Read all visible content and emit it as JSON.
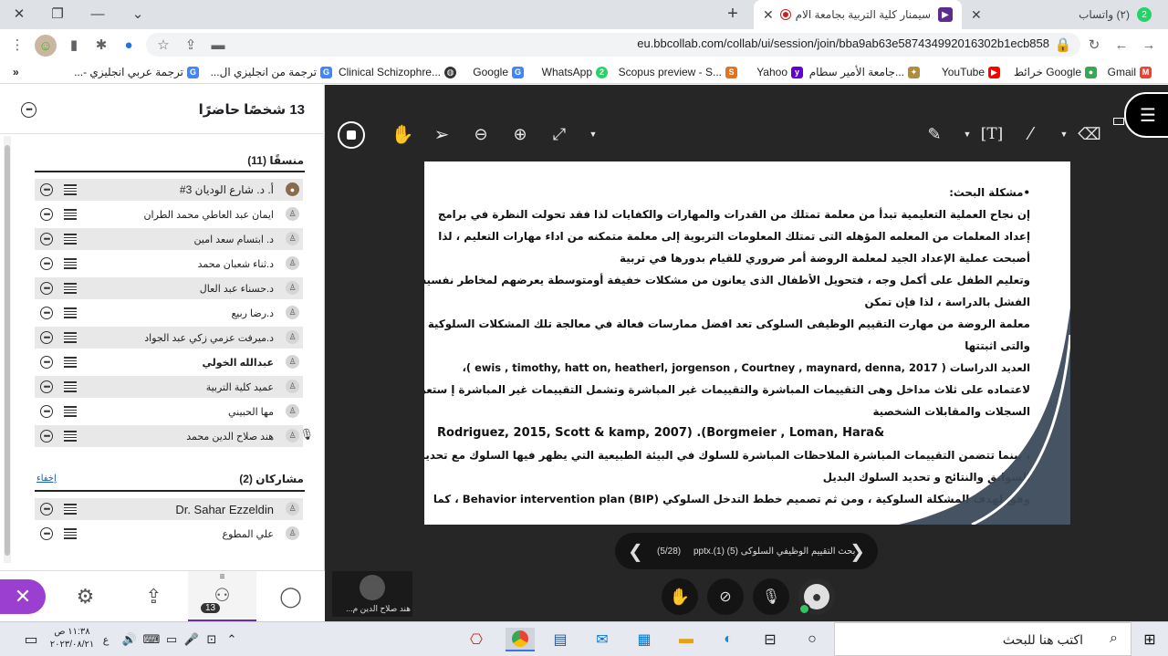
{
  "browser": {
    "tabs": [
      {
        "title": "(٢) واتساب",
        "badge": "2"
      },
      {
        "title": "سيمنار كلية التربية بجامعة الام",
        "active": true
      }
    ],
    "url": "eu.bbcollab.com/collab/ui/session/join/bba9ab63e587434992016302b1ecb858",
    "bookmarks": [
      "Gmail",
      "خرائط Google",
      "YouTube",
      "جامعة الأمير سطام...",
      "Yahoo",
      "Scopus preview - S...",
      "WhatsApp",
      "Google",
      "Clinical Schizophre...",
      "ترجمة من انجليزي ال...",
      "ترجمة عربي انجليزي -..."
    ],
    "more_bookmarks": "»"
  },
  "panel": {
    "title": "13 شخصًا حاضرًا",
    "moderators_heading": "منسقًا (11)",
    "moderators": [
      "أ. د. شارع الوديان 3#",
      "ايمان عبد العاطي محمد الطران",
      "د. ابتسام سعد امين",
      "د.ثناء شعبان محمد",
      "د.حسناء عبد العال",
      "د.رضا ربيع",
      "د.ميرفت عزمي زكي عبد الجواد",
      "عبدالله الخولي",
      "عميد كلية التربية",
      "مها الحبيني",
      "هند صلاح الدين محمد"
    ],
    "participants_heading": "مشاركان (2)",
    "hide_label": "إخفاء",
    "participants": [
      "Dr. Sahar Ezzeldin",
      "علي المطوع"
    ],
    "attendee_count": "13"
  },
  "slide": {
    "lines": [
      "•مشكلة البحث:",
      "إن نجاح العملية التعليمية تبدأ من معلمة تمتلك من القدرات والمهارات والكفايات لذا فقد  تحولت النظرة في برامج",
      "إعداد المعلمات من المعلمه المؤهله التى تمتلك المعلومات التربوية إلى  معلمة متمكنه من اداء مهارات التعليم ، لذا",
      "أصبحت عملية الإعداد الجيد لمعلمة الروضة أمر ضروري للقيام بدورها في تربية",
      "وتعليم الطفل على أكمل وجه ، فتحويل الأطفال الذى يعانون من مشكلات خفيفة أومتوسطة يعرضهم  لمخاطر نفسيه او",
      "الفشل بالدراسة ، لذا فإن تمكن",
      "معلمة الروضة من مهارت التقييم الوظيفى السلوكى تعد افضل ممارسات فعالة في معالجة  تلك المشكلات السلوكية",
      "والتى اثبتتها",
      "العديد الدراسات ( ewis , timothy, hatt on, heatherl, jorgenson , Courtney , maynard, denna, 2017 )،",
      "لاعتماده على ثلاث مداخل وهى التقييمات المباشرة والتقييمات غير المباشرة وتشمل التقييمات غير المباشرة إ ستعراض",
      "السجلات والمقابلات الشخصية",
      "Rodriguez, 2015, Scott & kamp, 2007) .(Borgmeier , Loman, Hara&",
      "، بينما تتضمن التقييمات المباشرة الملاحظات المباشرة للسلوك في البيئة الطبيعية التي يظهر فيها السلوك مع تحديد",
      "السوابق والنتائج و تحديد السلوك البديل",
      "وفق لهدف المشكلة السلوكية ، ومن ثم تصميم خطط التدخل السلوكي  Behavior intervention plan (BIP) ،  كما"
    ]
  },
  "pager": {
    "file": "بحث التقييم الوظيفي السلوكى (5) (1).pptx",
    "page": "(5/28)"
  },
  "presenter_name": "هند صلاح الدين م...",
  "taskbar": {
    "search_placeholder": "اكتب هنا للبحث",
    "time": "١١:٣٨ ص",
    "date": "٢٠٢٣/٠٨/٢١",
    "lang": "ع"
  }
}
